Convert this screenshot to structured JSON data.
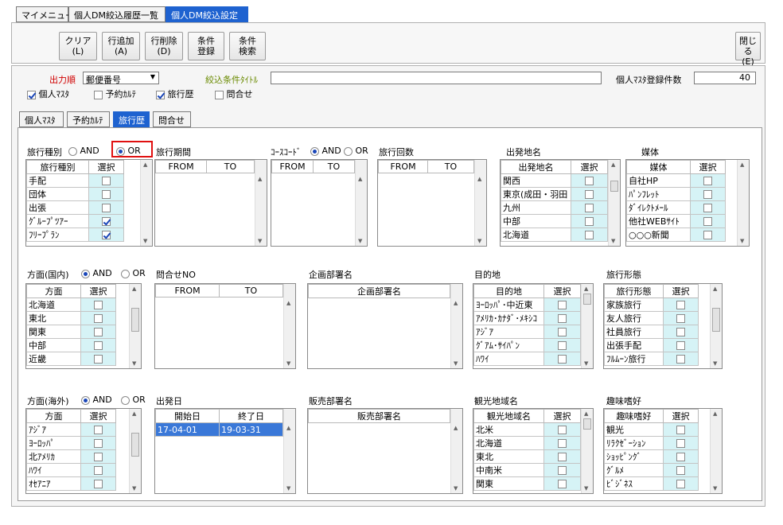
{
  "tabs": [
    "マイメニュー",
    "個人DM絞込履歴一覧",
    "個人DM絞込設定"
  ],
  "toolbar": {
    "clear": "クリア\n(L)",
    "add_row": "行追加\n(A)",
    "del_row": "行削除\n(D)",
    "cond_reg": "条件\n登録",
    "cond_search": "条件\n検索",
    "close": "閉じる\n(E)"
  },
  "order": {
    "label": "出力順",
    "value": "郵便番号"
  },
  "filter_title": {
    "label": "絞込条件ﾀｲﾄﾙ",
    "value": ""
  },
  "count": {
    "label": "個人ﾏｽﾀ登録件数",
    "value": "40"
  },
  "checks": [
    {
      "label": "個人ﾏｽﾀ",
      "checked": true
    },
    {
      "label": "予約ｶﾙﾃ",
      "checked": false
    },
    {
      "label": "旅行歴",
      "checked": true
    },
    {
      "label": "問合せ",
      "checked": false
    }
  ],
  "subtabs": [
    "個人ﾏｽﾀ",
    "予約ｶﾙﾃ",
    "旅行歴",
    "問合せ"
  ],
  "andor": {
    "and": "AND",
    "or": "OR"
  },
  "sec": {
    "travel_type": "旅行種別",
    "period": "旅行期間",
    "course": "ｺｰｽｺｰﾄﾞ",
    "times": "旅行回数",
    "departure": "出発地名",
    "media": "媒体",
    "dom": "方面(国内)",
    "inquiry": "問合せNO",
    "plan_dept": "企画部署名",
    "dest": "目的地",
    "form": "旅行形態",
    "ovs": "方面(海外)",
    "dep_date": "出発日",
    "sales_dept": "販売部署名",
    "sight": "観光地域名",
    "hobby": "趣味嗜好"
  },
  "hdr": {
    "select": "選択",
    "from": "FROM",
    "to": "TO",
    "start": "開始日",
    "end": "終了日"
  },
  "travel_type_rows": [
    {
      "n": "手配",
      "c": false
    },
    {
      "n": "団体",
      "c": false
    },
    {
      "n": "出張",
      "c": false
    },
    {
      "n": "ｸﾞﾙｰﾌﾟﾂｱｰ",
      "c": true
    },
    {
      "n": "ﾌﾘｰﾌﾟﾗﾝ",
      "c": true
    }
  ],
  "departure_rows": [
    {
      "n": "関西",
      "c": false
    },
    {
      "n": "東京(成田・羽田",
      "c": false
    },
    {
      "n": "九州",
      "c": false
    },
    {
      "n": "中部",
      "c": false
    },
    {
      "n": "北海道",
      "c": false
    }
  ],
  "media_rows": [
    {
      "n": "自社HP",
      "c": false
    },
    {
      "n": "ﾊﾟﾝﾌﾚｯﾄ",
      "c": false
    },
    {
      "n": "ﾀﾞｲﾚｸﾄﾒｰﾙ",
      "c": false
    },
    {
      "n": "他社WEBｻｲﾄ",
      "c": false
    },
    {
      "n": "○○○新聞",
      "c": false
    }
  ],
  "dom_rows": [
    {
      "n": "北海道",
      "c": false
    },
    {
      "n": "東北",
      "c": false
    },
    {
      "n": "関東",
      "c": false
    },
    {
      "n": "中部",
      "c": false
    },
    {
      "n": "近畿",
      "c": false
    }
  ],
  "dest_rows": [
    {
      "n": "ﾖｰﾛｯﾊﾟ･中近東",
      "c": false
    },
    {
      "n": "ｱﾒﾘｶ･ｶﾅﾀﾞ･ﾒｷｼｺ",
      "c": false
    },
    {
      "n": "ｱｼﾞｱ",
      "c": false
    },
    {
      "n": "ｸﾞｱﾑ･ｻｲﾊﾟﾝ",
      "c": false
    },
    {
      "n": "ﾊﾜｲ",
      "c": false
    }
  ],
  "form_rows": [
    {
      "n": "家族旅行",
      "c": false
    },
    {
      "n": "友人旅行",
      "c": false
    },
    {
      "n": "社員旅行",
      "c": false
    },
    {
      "n": "出張手配",
      "c": false
    },
    {
      "n": "ﾌﾙﾑｰﾝ旅行",
      "c": false
    }
  ],
  "ovs_rows": [
    {
      "n": "ｱｼﾞｱ",
      "c": false
    },
    {
      "n": "ﾖｰﾛｯﾊﾟ",
      "c": false
    },
    {
      "n": "北ｱﾒﾘｶ",
      "c": false
    },
    {
      "n": "ﾊﾜｲ",
      "c": false
    },
    {
      "n": "ｵｾｱﾆｱ",
      "c": false
    }
  ],
  "dep_date_row": {
    "start": "17-04-01",
    "end": "19-03-31"
  },
  "sight_rows": [
    {
      "n": "北米",
      "c": false
    },
    {
      "n": "北海道",
      "c": false
    },
    {
      "n": "東北",
      "c": false
    },
    {
      "n": "中南米",
      "c": false
    },
    {
      "n": "関東",
      "c": false
    }
  ],
  "hobby_rows": [
    {
      "n": "観光",
      "c": false
    },
    {
      "n": "ﾘﾗｸｾﾞｰｼｮﾝ",
      "c": false
    },
    {
      "n": "ｼｮｯﾋﾟﾝｸﾞ",
      "c": false
    },
    {
      "n": "ｸﾞﾙﾒ",
      "c": false
    },
    {
      "n": "ﾋﾞｼﾞﾈｽ",
      "c": false
    }
  ],
  "colors": {
    "accent": "#1e62d0",
    "order_label": "#d00000",
    "highlight_border": "#e01010",
    "cell_bg": "#d6f3f6"
  }
}
